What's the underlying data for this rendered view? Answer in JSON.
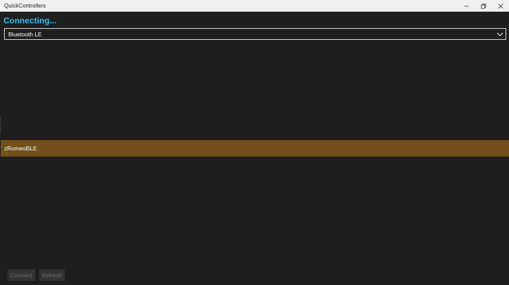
{
  "window": {
    "title": "QuickControllers",
    "controls": {
      "minimize_icon": "minimize-icon",
      "maximize_icon": "restore-icon",
      "close_icon": "close-icon"
    }
  },
  "header": {
    "status": "Connecting..."
  },
  "connection_type": {
    "selected": "Bluetooth LE",
    "icon": "chevron-down-icon"
  },
  "devices": {
    "items": [
      {
        "label": "zRomeoBLE",
        "selected": true
      }
    ]
  },
  "actions": {
    "connect_label": "Connect",
    "refresh_label": "Refresh"
  },
  "colors": {
    "accent": "#2ec3ee",
    "selection": "#734f1b",
    "background": "#1f1f1f"
  }
}
